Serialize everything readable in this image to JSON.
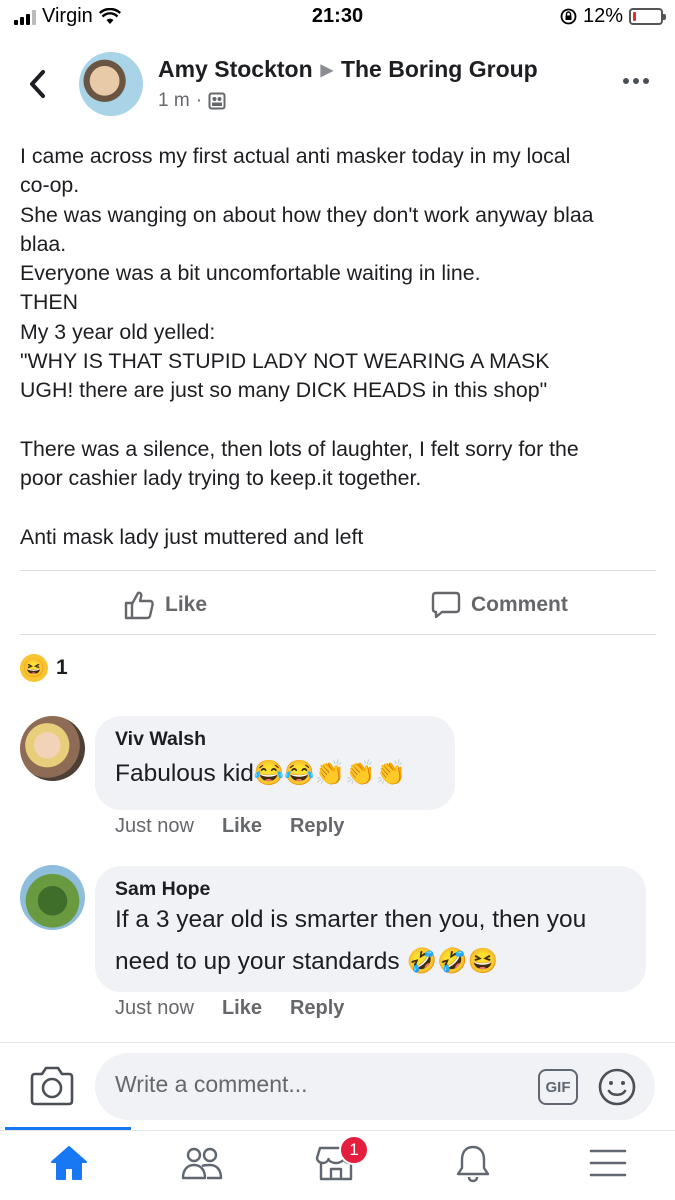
{
  "status_bar": {
    "carrier": "Virgin",
    "time": "21:30",
    "battery_percent_label": "12%",
    "battery_level": 0.12
  },
  "post": {
    "author": "Amy Stockton",
    "group": "The Boring Group",
    "timestamp": "1 m",
    "meta_separator": "·",
    "body_lines": [
      "I came across my first actual anti masker today in my local",
      "co-op.",
      "She was wanging on about how they don't work anyway blaa",
      "blaa.",
      "Everyone was a bit uncomfortable waiting in line.",
      "THEN",
      "My 3 year old yelled:",
      "\"WHY IS THAT STUPID LADY NOT WEARING A MASK",
      "UGH! there are just so many DICK HEADS in this shop\"",
      "",
      "There was a silence, then lots of laughter, I felt sorry for the",
      "poor cashier lady trying to keep.it together.",
      "",
      "Anti mask lady just muttered and left"
    ],
    "actions": {
      "like_label": "Like",
      "comment_label": "Comment"
    },
    "reactions": {
      "emoji": "😆",
      "count": "1"
    }
  },
  "comments": [
    {
      "author": "Viv Walsh",
      "text": "Fabulous kid😂😂👏👏👏",
      "time": "Just now",
      "like_label": "Like",
      "reply_label": "Reply"
    },
    {
      "author": "Sam Hope",
      "text": "If a 3 year old is smarter then you, then you need to up your standards 🤣🤣😆",
      "time": "Just now",
      "like_label": "Like",
      "reply_label": "Reply"
    }
  ],
  "composer": {
    "placeholder": "Write a comment...",
    "gif_label": "GIF"
  },
  "bottom_nav": {
    "items": [
      "home-icon",
      "groups-icon",
      "marketplace-icon",
      "notifications-icon",
      "menu-icon"
    ],
    "active": "home-icon",
    "marketplace_badge": "1"
  },
  "colors": {
    "accent": "#1877f2",
    "badge": "#e41e3f",
    "secondary_text": "#65676b",
    "bubble": "#f0f2f5"
  }
}
